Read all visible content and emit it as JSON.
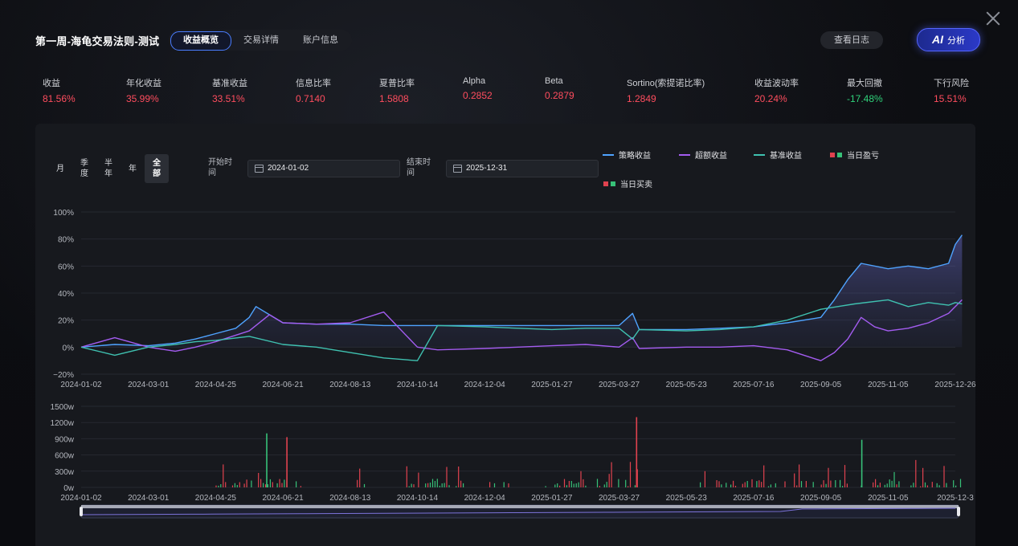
{
  "header": {
    "title": "第一周-海龟交易法则-测试",
    "tabs": [
      "收益概览",
      "交易详情",
      "账户信息"
    ],
    "active_tab": 0,
    "log_button": "查看日志",
    "ai_button_prefix": "AI",
    "ai_button_label": "分析"
  },
  "metrics": [
    {
      "label": "收益",
      "value": "81.56%",
      "tone": "red"
    },
    {
      "label": "年化收益",
      "value": "35.99%",
      "tone": "red"
    },
    {
      "label": "基准收益",
      "value": "33.51%",
      "tone": "red"
    },
    {
      "label": "信息比率",
      "value": "0.7140",
      "tone": "red"
    },
    {
      "label": "夏普比率",
      "value": "1.5808",
      "tone": "red"
    },
    {
      "label": "Alpha",
      "value": "0.2852",
      "tone": "red"
    },
    {
      "label": "Beta",
      "value": "0.2879",
      "tone": "red"
    },
    {
      "label": "Sortino(索提诺比率)",
      "value": "1.2849",
      "tone": "red"
    },
    {
      "label": "收益波动率",
      "value": "20.24%",
      "tone": "red"
    },
    {
      "label": "最大回撤",
      "value": "-17.48%",
      "tone": "green"
    },
    {
      "label": "下行风险",
      "value": "15.51%",
      "tone": "red"
    }
  ],
  "controls": {
    "periods": [
      {
        "lines": [
          "月"
        ]
      },
      {
        "lines": [
          "季",
          "度"
        ]
      },
      {
        "lines": [
          "半",
          "年"
        ]
      },
      {
        "lines": [
          "年"
        ]
      },
      {
        "lines": [
          "全",
          "部"
        ],
        "active": true
      }
    ],
    "start_label_lines": [
      "开始时",
      "间"
    ],
    "start_date": "2024-01-02",
    "end_label_lines": [
      "结束时",
      "间"
    ],
    "end_date": "2025-12-31"
  },
  "legend": {
    "strategy": "策略收益",
    "excess": "超额收益",
    "benchmark": "基准收益",
    "daily_pnl": "当日盈亏",
    "daily_trade": "当日买卖"
  },
  "colors": {
    "strategy": "#4fa3ff",
    "excess": "#a35cf0",
    "benchmark": "#3fc1b0",
    "red": "#e0424f",
    "green": "#37c178"
  },
  "chart_data": [
    {
      "type": "line",
      "x_ticks": [
        "2024-01-02",
        "2024-03-01",
        "2024-04-25",
        "2024-06-21",
        "2024-08-13",
        "2024-10-14",
        "2024-12-04",
        "2025-01-27",
        "2025-03-27",
        "2025-05-23",
        "2025-07-16",
        "2025-09-05",
        "2025-11-05",
        "2025-12-26"
      ],
      "y_ticks": [
        "100%",
        "80%",
        "60%",
        "40%",
        "20%",
        "0%",
        "−20%"
      ],
      "ylim": [
        -20,
        100
      ],
      "series": [
        {
          "name": "策略收益",
          "x_index": [
            0,
            0.5,
            1,
            1.4,
            1.7,
            2,
            2.3,
            2.5,
            2.6,
            3,
            3.5,
            4,
            4.5,
            5,
            5.3,
            6,
            6.5,
            7,
            7.5,
            8,
            8.2,
            8.3,
            9,
            9.5,
            10,
            10.5,
            11,
            11.2,
            11.4,
            11.6,
            12,
            12.3,
            12.6,
            12.9,
            13,
            13.1
          ],
          "values": [
            0,
            2,
            1,
            3,
            6,
            10,
            14,
            22,
            30,
            18,
            17,
            17,
            16,
            16,
            16,
            16,
            16,
            16,
            16,
            16,
            25,
            13,
            13,
            14,
            15,
            18,
            22,
            35,
            50,
            62,
            58,
            60,
            58,
            62,
            76,
            83
          ]
        },
        {
          "name": "超额收益",
          "x_index": [
            0,
            0.5,
            1,
            1.4,
            1.7,
            2,
            2.5,
            2.8,
            3,
            3.5,
            4,
            4.5,
            5,
            5.3,
            6,
            6.5,
            7,
            7.5,
            8,
            8.2,
            8.3,
            9,
            9.5,
            10,
            10.5,
            11,
            11.2,
            11.4,
            11.6,
            11.8,
            12,
            12.3,
            12.6,
            12.9,
            13,
            13.1
          ],
          "values": [
            0,
            7,
            0,
            -3,
            0,
            4,
            12,
            24,
            18,
            17,
            18,
            26,
            0,
            -2,
            -1,
            0,
            1,
            2,
            0,
            7,
            -1,
            0,
            0,
            1,
            -2,
            -10,
            -4,
            6,
            22,
            15,
            12,
            14,
            18,
            25,
            30,
            35
          ]
        },
        {
          "name": "基准收益",
          "x_index": [
            0,
            0.5,
            1,
            1.4,
            1.7,
            2,
            2.5,
            3,
            3.5,
            4,
            4.5,
            5,
            5.3,
            6,
            6.5,
            7,
            7.5,
            8,
            8.2,
            8.3,
            9,
            9.5,
            10,
            10.5,
            11,
            11.5,
            12,
            12.3,
            12.6,
            12.9,
            13,
            13.1
          ],
          "values": [
            0,
            -6,
            0,
            2,
            4,
            5,
            8,
            2,
            0,
            -4,
            -8,
            -10,
            16,
            15,
            14,
            13,
            14,
            14,
            6,
            13,
            12,
            13,
            15,
            20,
            28,
            32,
            35,
            30,
            33,
            31,
            33,
            32
          ]
        }
      ]
    },
    {
      "type": "bar",
      "title": "当日买卖",
      "y_ticks": [
        "1500w",
        "1200w",
        "900w",
        "600w",
        "300w",
        "0w"
      ],
      "ylim": [
        0,
        1500
      ],
      "x_ticks": [
        "2024-01-02",
        "2024-03-01",
        "2024-04-25",
        "2024-06-21",
        "2024-08-13",
        "2024-10-14",
        "2024-12-04",
        "2025-01-27",
        "2025-03-27",
        "2025-05-23",
        "2025-07-16",
        "2025-09-05",
        "2025-11-05",
        "2025-12-3"
      ],
      "notable_bars": [
        {
          "x_index": 2.75,
          "value": 1000,
          "side": "buy"
        },
        {
          "x_index": 3.05,
          "value": 930,
          "side": "sell"
        },
        {
          "x_index": 8.25,
          "value": 1300,
          "side": "sell"
        },
        {
          "x_index": 11.6,
          "value": 880,
          "side": "buy"
        }
      ]
    }
  ]
}
